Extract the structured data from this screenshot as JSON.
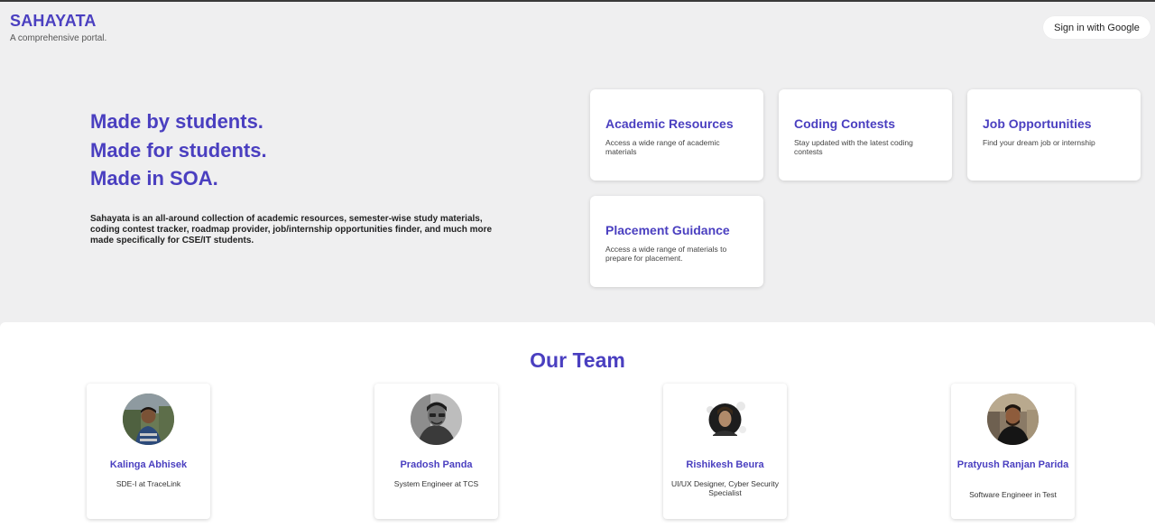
{
  "header": {
    "title": "SAHAYATA",
    "subtitle": "A comprehensive portal.",
    "signin_label": "Sign in with Google"
  },
  "hero": {
    "lines": [
      "Made by students.",
      "Made for students.",
      "Made in SOA."
    ],
    "description": "Sahayata is an all-around collection of academic resources, semester-wise study materials, coding contest tracker, roadmap provider, job/internship opportunities finder, and much more made specifically for CSE/IT students."
  },
  "features": [
    {
      "title": "Academic Resources",
      "desc": "Access a wide range of academic materials"
    },
    {
      "title": "Coding Contests",
      "desc": "Stay updated with the latest coding contests"
    },
    {
      "title": "Job Opportunities",
      "desc": "Find your dream job or internship"
    },
    {
      "title": "Placement Guidance",
      "desc": "Access a wide range of materials to prepare for placement."
    }
  ],
  "team": {
    "title": "Our Team",
    "members": [
      {
        "name": "Kalinga Abhisek",
        "role": "SDE-I at TraceLink"
      },
      {
        "name": "Pradosh Panda",
        "role": "System Engineer at TCS"
      },
      {
        "name": "Rishikesh Beura",
        "role": "UI/UX Designer, Cyber Security Specialist"
      },
      {
        "name": "Pratyush Ranjan Parida",
        "role": "Software Engineer in Test"
      }
    ]
  }
}
